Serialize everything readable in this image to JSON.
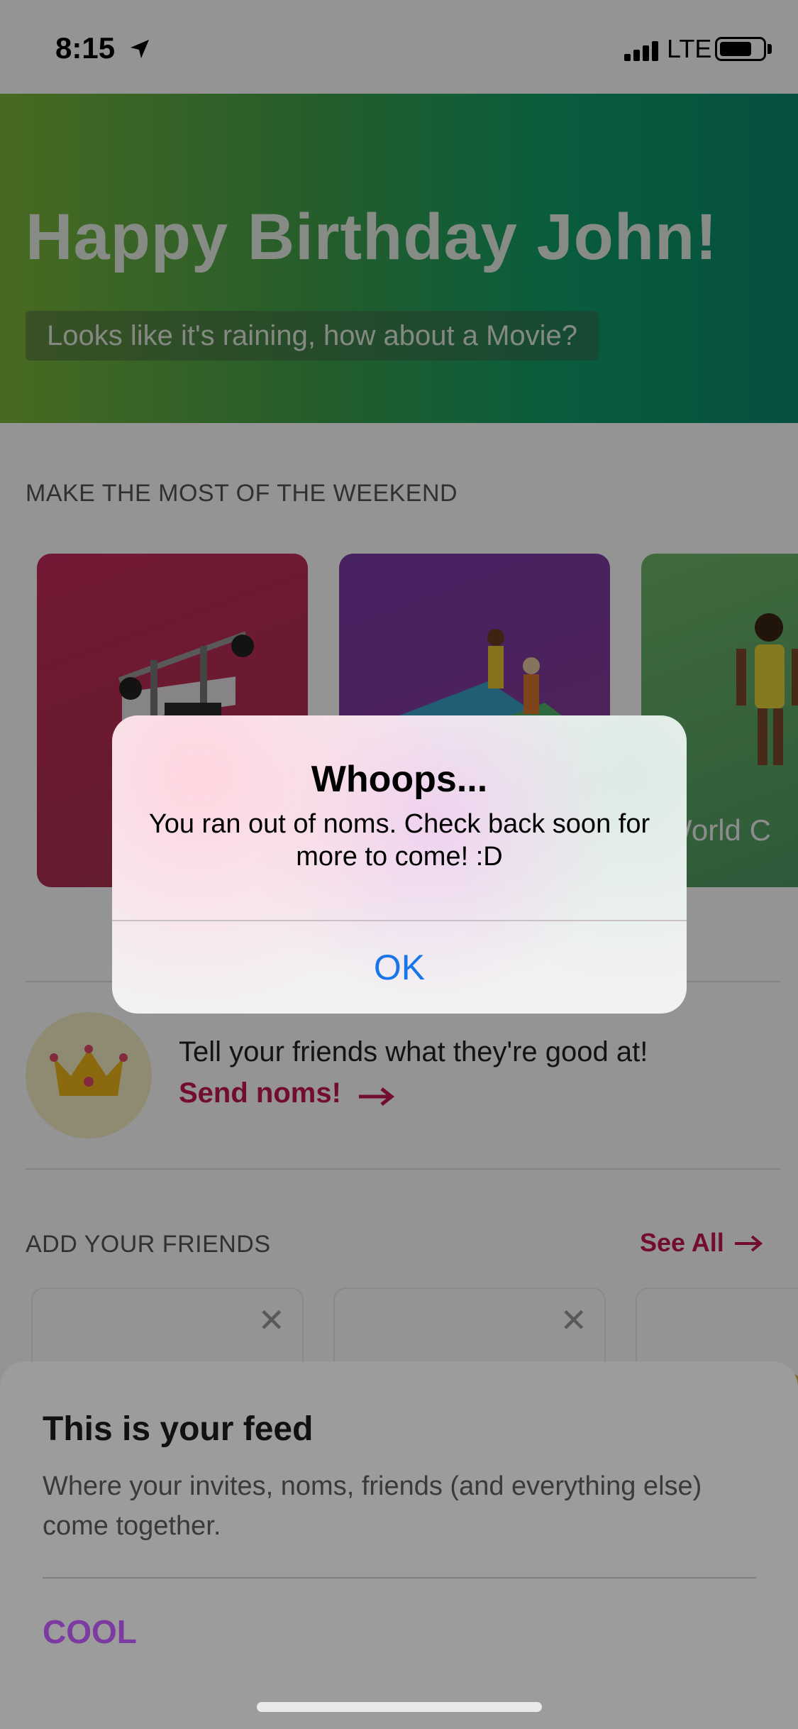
{
  "status_bar": {
    "time": "8:15",
    "network": "LTE"
  },
  "hero": {
    "title": "Happy Birthday John!",
    "subtitle": "Looks like it's raining, how about a Movie?"
  },
  "weekend": {
    "heading": "MAKE THE MOST OF THE WEEKEND",
    "cards": [
      {
        "label": ""
      },
      {
        "label": ""
      },
      {
        "label": "World C"
      }
    ]
  },
  "noms": {
    "text": "Tell your friends what they're good at!",
    "link": "Send noms!"
  },
  "friends": {
    "heading": "ADD YOUR FRIENDS",
    "see_all": "See All",
    "close_glyph": "✕"
  },
  "alert": {
    "title": "Whoops...",
    "message": "You ran out of noms. Check back soon for more to come! :D",
    "ok_label": "OK"
  },
  "sheet": {
    "title": "This is your feed",
    "body": "Where your invites, noms, friends (and everything else) come together.",
    "button_label": "COOL"
  },
  "colors": {
    "accent_red": "#c4174f",
    "accent_purple": "#7c3ba0",
    "ios_blue": "#1a76e8"
  }
}
